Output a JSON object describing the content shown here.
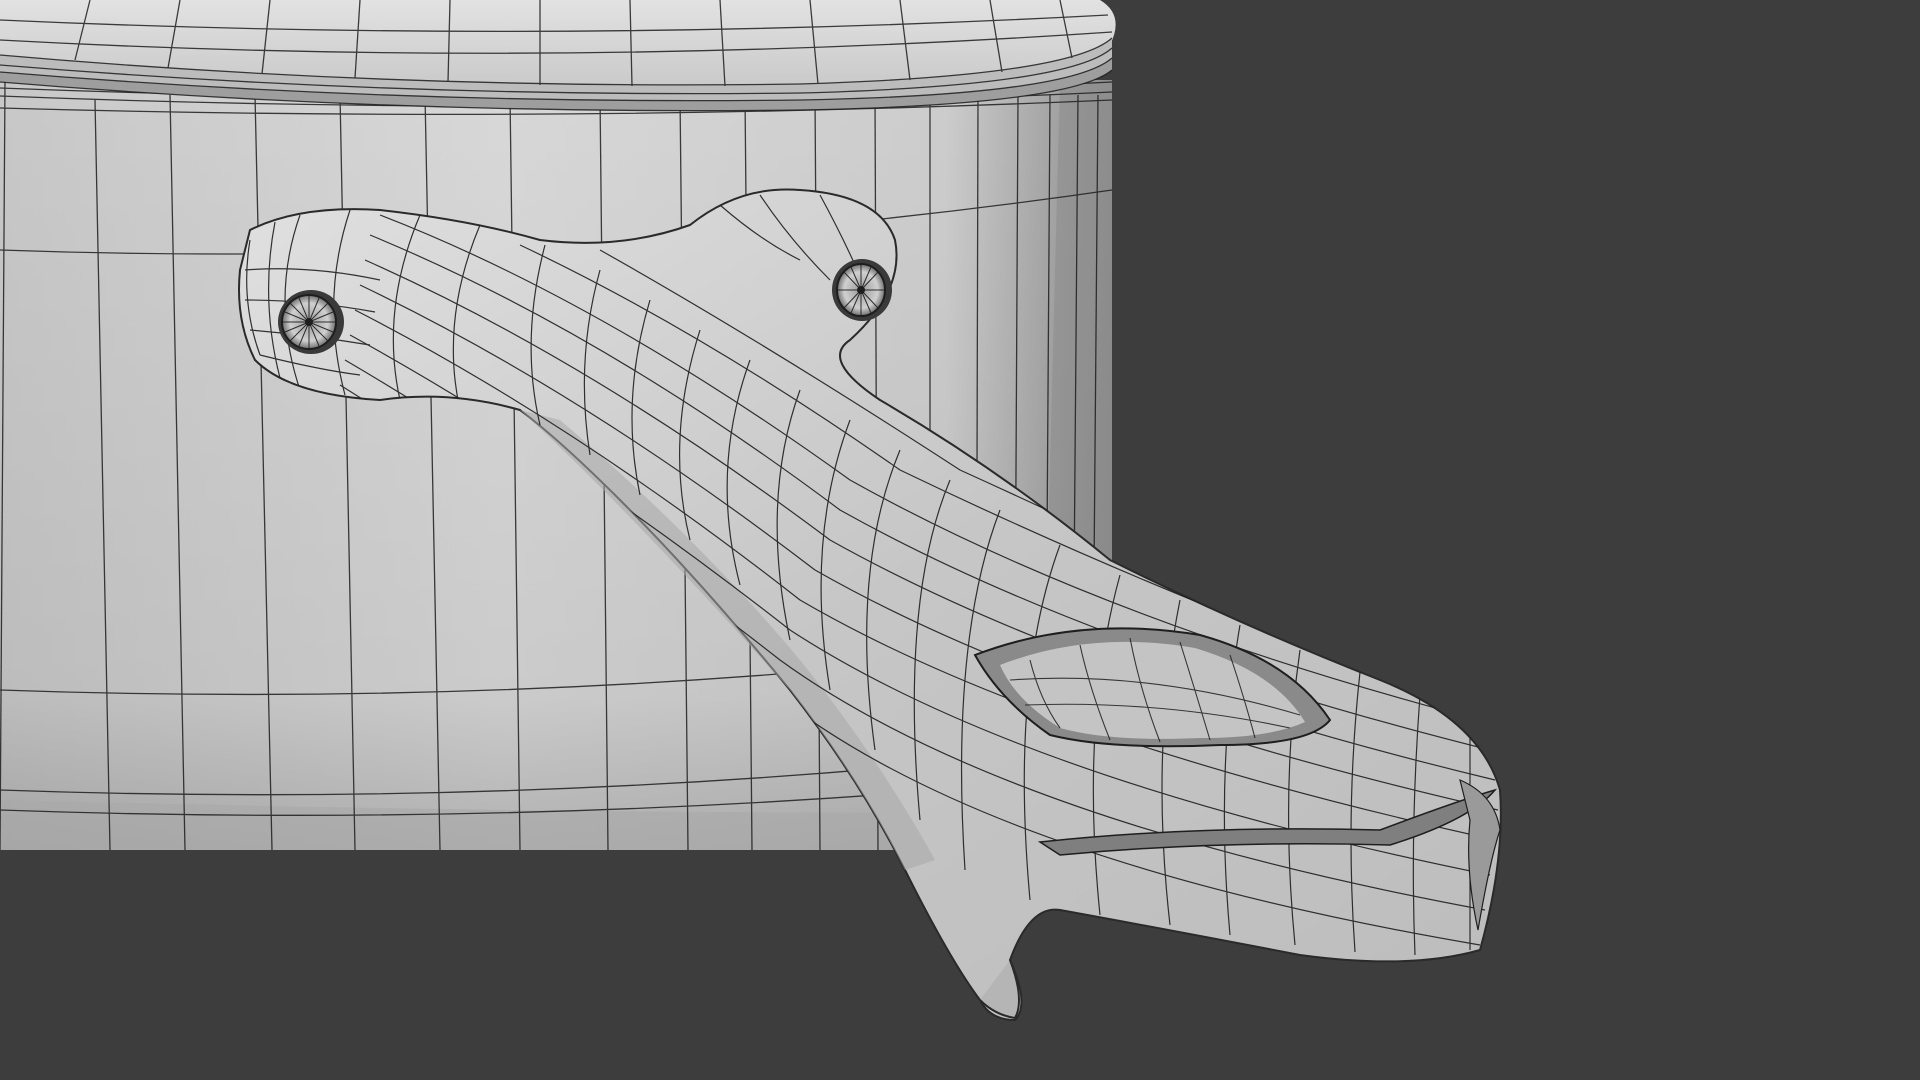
{
  "scene": {
    "subject": "saucepan-with-handle",
    "render_mode": "wireframe-on-shaded",
    "colors": {
      "background": "#3d3d3d",
      "surface_light": "#d9d9d9",
      "surface_mid": "#b4b4b4",
      "surface_dark": "#8a8a8a",
      "wire": "#1e1e1e"
    }
  }
}
